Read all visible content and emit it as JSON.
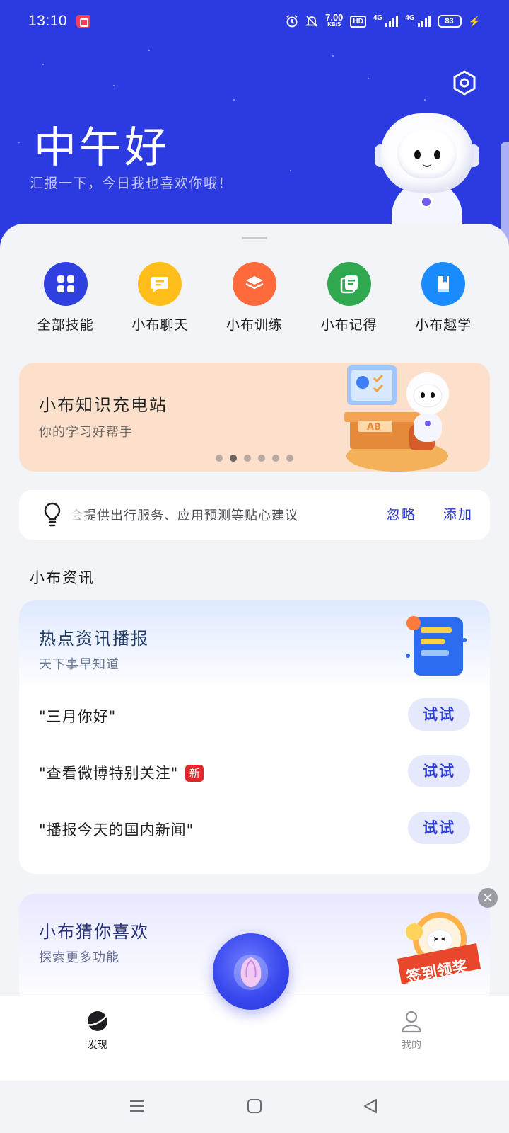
{
  "status_bar": {
    "time": "13:10",
    "speed_value": "7.00",
    "speed_unit": "KB/S",
    "hd": "HD",
    "net1": "4G",
    "net2": "4G",
    "battery": "83"
  },
  "header": {
    "greeting": "中午好",
    "subtitle": "汇报一下，今日我也喜欢你哦！",
    "settings_icon": "hexagon-gear-icon"
  },
  "shortcuts": [
    {
      "label": "全部技能",
      "icon": "grid-icon",
      "color": "#2f3fe0"
    },
    {
      "label": "小布聊天",
      "icon": "chat-icon",
      "color": "#ffbe1a"
    },
    {
      "label": "小布训练",
      "icon": "layers-icon",
      "color": "#ff6a3c"
    },
    {
      "label": "小布记得",
      "icon": "notes-icon",
      "color": "#2fa84f"
    },
    {
      "label": "小布趣学",
      "icon": "book-icon",
      "color": "#1a8cff"
    }
  ],
  "banner": {
    "title": "小布知识充电站",
    "subtitle": "你的学习好帮手",
    "dots": 6,
    "active_dot": 1
  },
  "suggestion": {
    "text": "会提供出行服务、应用预测等贴心建议",
    "ignore_label": "忽略",
    "add_label": "添加"
  },
  "news": {
    "section_title": "小布资讯",
    "card_title": "热点资讯播报",
    "card_subtitle": "天下事早知道",
    "rows": [
      {
        "text": "\"三月你好\"",
        "badge": "",
        "button": "试试"
      },
      {
        "text": "\"查看微博特别关注\"",
        "badge": "新",
        "button": "试试"
      },
      {
        "text": "\"播报今天的国内新闻\"",
        "badge": "",
        "button": "试试"
      }
    ]
  },
  "recommend": {
    "title": "小布猜你喜欢",
    "subtitle": "探索更多功能"
  },
  "promo": {
    "label": "签到领奖",
    "close": "×"
  },
  "bottom_nav": {
    "discover_label": "发现",
    "mine_label": "我的"
  },
  "colors": {
    "brand": "#2c3be0",
    "accent_text": "#2d3dd6"
  }
}
